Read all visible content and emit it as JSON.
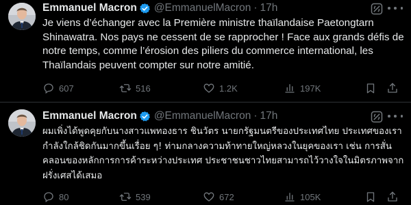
{
  "tweets": [
    {
      "author_name": "Emmanuel Macron",
      "handle": "@EmmanuelMacron",
      "separator": "·",
      "time": "17h",
      "text": "Je viens d’échanger avec la Première ministre thaïlandaise Paetongtarn Shinawatra. Nos pays ne cessent de se rapprocher ! Face aux grands défis de notre temps, comme l’érosion des piliers du commerce international, les Thaïlandais peuvent compter sur notre amitié.",
      "replies": "607",
      "reposts": "516",
      "likes": "1.2K",
      "views": "197K"
    },
    {
      "author_name": "Emmanuel Macron",
      "handle": "@EmmanuelMacron",
      "separator": "·",
      "time": "17h",
      "text": "ผมเพิ่งได้พูดคุยกับนางสาวแพทองธาร ชินวัตร นายกรัฐมนตรีของประเทศไทย ประเทศของเรากำลังใกล้ชิดกันมากขึ้นเรื่อย ๆ! ท่ามกลางความท้าทายใหญ่หลวงในยุคของเรา เช่น การสั่นคลอนของหลักการการค้าระหว่างประเทศ ประชาชนชาวไทยสามารถไว้วางใจในมิตรภาพจากฝรั่งเศสได้เสมอ",
      "replies": "80",
      "reposts": "539",
      "likes": "672",
      "views": "105K"
    }
  ],
  "icons": {
    "verified": "verified-badge-icon",
    "grok": "grok-icon",
    "more": "more-options-icon",
    "reply": "reply-icon",
    "repost": "repost-icon",
    "like": "heart-icon",
    "views": "views-chart-icon",
    "bookmark": "bookmark-icon",
    "share": "share-icon"
  },
  "colors": {
    "background": "#000000",
    "text": "#e7e9ea",
    "muted": "#71767b",
    "verified": "#1d9bf0",
    "divider": "#2f3336"
  }
}
